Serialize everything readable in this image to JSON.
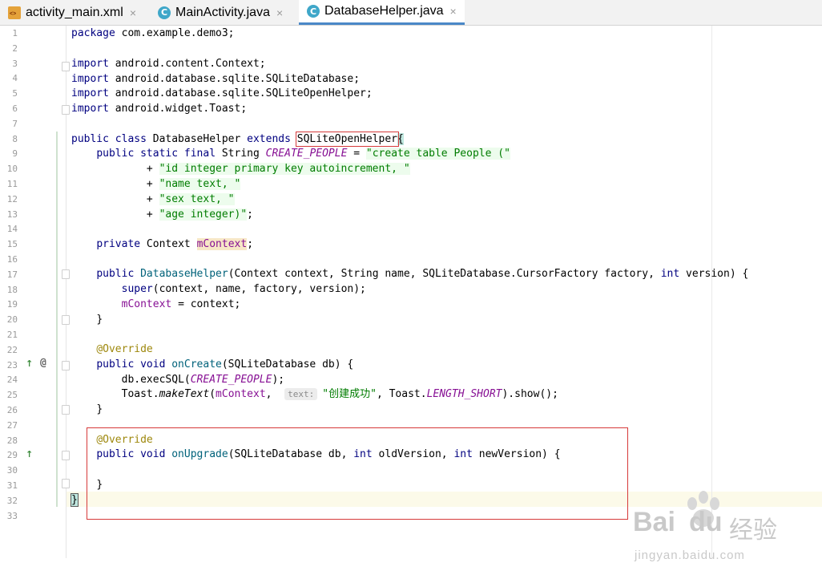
{
  "tabs": [
    {
      "label": "activity_main.xml",
      "icon": "xml-file-icon",
      "active": false
    },
    {
      "label": "MainActivity.java",
      "icon": "class-file-icon",
      "active": false
    },
    {
      "label": "DatabaseHelper.java",
      "icon": "class-file-icon",
      "active": true
    }
  ],
  "close_glyph": "×",
  "class_icon_letter": "C",
  "code": {
    "l1": {
      "kw": "package",
      "rest": " com.example.demo3;"
    },
    "l3": {
      "kw": "import",
      "rest": " android.content.Context;"
    },
    "l4": {
      "kw": "import",
      "rest": " android.database.sqlite.SQLiteDatabase;"
    },
    "l5": {
      "kw": "import",
      "rest": " android.database.sqlite.SQLiteOpenHelper;"
    },
    "l6": {
      "kw": "import",
      "rest": " android.widget.Toast;"
    },
    "l8": {
      "kw1": "public class",
      "cls": " DatabaseHelper ",
      "kw2": "extends",
      "sp": " ",
      "sup": "SQLiteOpenHelper",
      "brace": "{"
    },
    "l9": {
      "indent": "    ",
      "kw": "public static final",
      "type": " String ",
      "cst": "CREATE_PEOPLE",
      "eq": " = ",
      "str": "\"create table People (\""
    },
    "l10": {
      "indent": "            ",
      "op": "+ ",
      "str": "\"id integer primary key autoincrement, \""
    },
    "l11": {
      "indent": "            ",
      "op": "+ ",
      "str": "\"name text, \""
    },
    "l12": {
      "indent": "            ",
      "op": "+ ",
      "str": "\"sex text, \""
    },
    "l13": {
      "indent": "            ",
      "op": "+ ",
      "str": "\"age integer)\"",
      "end": ";"
    },
    "l15": {
      "indent": "    ",
      "kw": "private",
      "type": " Context ",
      "fld": "mContext",
      "end": ";"
    },
    "l17": {
      "indent": "    ",
      "kw": "public",
      "sp": " ",
      "fn": "DatabaseHelper",
      "p1": "(Context context, String name, SQLiteDatabase.CursorFactory factory, ",
      "kw2": "int",
      "p2": " version) {"
    },
    "l18": {
      "indent": "        ",
      "kw": "super",
      "rest": "(context, name, factory, version);"
    },
    "l19": {
      "indent": "        ",
      "fld": "mContext",
      "rest": " = context;"
    },
    "l20": {
      "indent": "    ",
      "rest": "}"
    },
    "l22": {
      "indent": "    ",
      "ann": "@Override"
    },
    "l23": {
      "indent": "    ",
      "kw": "public void",
      "sp": " ",
      "fn": "onCreate",
      "rest": "(SQLiteDatabase db) {"
    },
    "l24": {
      "indent": "        ",
      "pre": "db.execSQL(",
      "cst": "CREATE_PEOPLE",
      "post": ");"
    },
    "l25": {
      "indent": "        ",
      "pre": "Toast.",
      "sm": "makeText",
      "p1": "(",
      "fld": "mContext",
      "p2": ",  ",
      "hint": "text:",
      "str": "\"创建成功\"",
      "p3": ", Toast.",
      "cst": "LENGTH_SHORT",
      "p4": ").show();"
    },
    "l26": {
      "indent": "    ",
      "rest": "}"
    },
    "l28": {
      "indent": "    ",
      "ann": "@Override"
    },
    "l29": {
      "indent": "    ",
      "kw": "public void",
      "sp": " ",
      "fn": "onUpgrade",
      "p1": "(SQLiteDatabase db, ",
      "kw2": "int",
      "p2": " oldVersion, ",
      "kw3": "int",
      "p3": " newVersion) {"
    },
    "l31": {
      "indent": "    ",
      "rest": "}"
    },
    "l32": {
      "rest": "}"
    }
  },
  "line_numbers": [
    "1",
    "2",
    "3",
    "4",
    "5",
    "6",
    "7",
    "8",
    "9",
    "10",
    "11",
    "12",
    "13",
    "14",
    "15",
    "16",
    "17",
    "18",
    "19",
    "20",
    "21",
    "22",
    "23",
    "24",
    "25",
    "26",
    "27",
    "28",
    "29",
    "30",
    "31",
    "32",
    "33"
  ],
  "gutter": {
    "at_glyph": "@"
  },
  "watermark": {
    "brand": "Bai",
    "brand2": "du",
    "cn": "经验",
    "url": "jingyan.baidu.com"
  }
}
